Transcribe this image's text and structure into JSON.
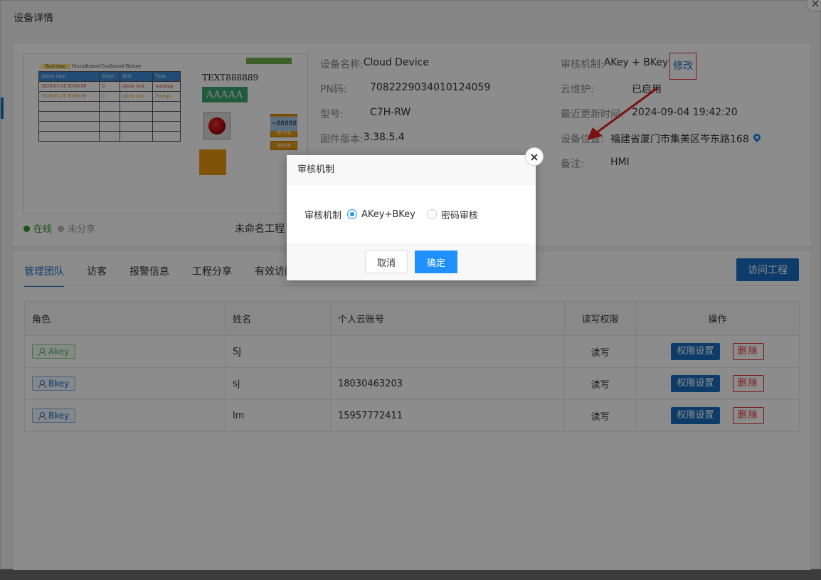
{
  "window": {
    "title": "设备详情",
    "close": "×"
  },
  "preview": {
    "title_tag": "Real time",
    "title_text": "Unconfirmed Confirmed History",
    "headers": [
      "Alarm time",
      "Value",
      "Text",
      "Type"
    ],
    "row1": [
      "2020-01-01 00:00:00",
      "0",
      "alarm text",
      "warning"
    ],
    "row2": [
      "2020-01-01 00:00:00",
      "0",
      "alarm text",
      "Prompt"
    ],
    "text_label": "TEXT888889",
    "aaa_label": "AAAAA",
    "num_label": "~88888",
    "btn1": "用户管理",
    "btn2": "用户登录",
    "btn3": "系统设置"
  },
  "status": {
    "online": "在线",
    "unshared": "未分享",
    "project_name": "未命名工程"
  },
  "device": {
    "name_label": "设备名称:",
    "name": "Cloud Device",
    "pn_label": "PN码:",
    "pn": "7082229034010124059",
    "model_label": "型号:",
    "model": "C7H-RW",
    "fw_label": "固件版本:",
    "fw": "3.38.5.4",
    "audit_label": "审核机制:",
    "audit": "AKey + BKey",
    "audit_edit": "修改",
    "cloud_label": "云维护:",
    "cloud": "已启用",
    "updated_label": "最近更新时间:",
    "updated": "2024-09-04 19:42:20",
    "location_label": "设备位置:",
    "location": "福建省厦门市集美区岑东路168",
    "remark_label": "备注:",
    "remark": "HMI"
  },
  "tabs": [
    "管理团队",
    "访客",
    "报警信息",
    "工程分享",
    "有效访问"
  ],
  "visit_button": "访问工程",
  "table": {
    "headers": [
      "角色",
      "姓名",
      "个人云账号",
      "读写权限",
      "操作"
    ],
    "rows": [
      {
        "role": "Akey",
        "name": "SJ",
        "account": "",
        "perm": "读写",
        "set": "权限设置",
        "del": "删除"
      },
      {
        "role": "Bkey",
        "name": "sj",
        "account": "18030463203",
        "perm": "读写",
        "set": "权限设置",
        "del": "删除"
      },
      {
        "role": "Bkey",
        "name": "lm",
        "account": "15957772411",
        "perm": "读写",
        "set": "权限设置",
        "del": "删除"
      }
    ]
  },
  "dialog": {
    "title": "审核机制",
    "close": "×",
    "field_label": "审核机制",
    "options": [
      "AKey+BKey",
      "密码审核"
    ],
    "selected": "AKey+BKey",
    "cancel": "取消",
    "ok": "确定"
  },
  "colors": {
    "primary": "#1b6dc1",
    "dialog_primary": "#1e90ff",
    "danger": "#e03030",
    "online": "#2a9a2a",
    "annotation": "#e02020"
  }
}
